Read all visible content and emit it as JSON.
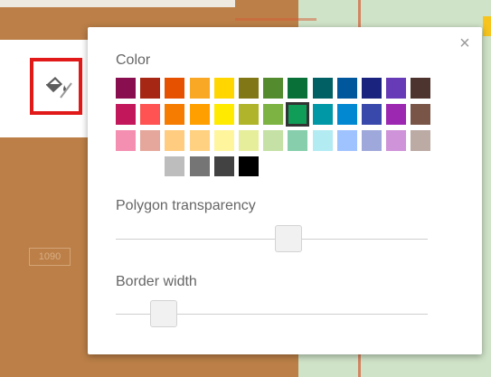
{
  "map": {
    "label_box": "1090"
  },
  "toolbar": {
    "fill_icon": "paint-bucket-icon"
  },
  "popup": {
    "close_label": "×",
    "color_label": "Color",
    "transparency_label": "Polygon transparency",
    "border_label": "Border width",
    "transparency_value": 0.56,
    "border_width_value": 0.12,
    "selected_color": "#0f9d58",
    "palette": [
      [
        "#880e4f",
        "#a52714",
        "#e65100",
        "#f9a825",
        "#ffd600",
        "#817717",
        "#558b2f",
        "#097138",
        "#006064",
        "#01579b",
        "#1a237e",
        "#673ab7",
        "#4e342e"
      ],
      [
        "#c2185b",
        "#ff5252",
        "#f57c00",
        "#ffa000",
        "#ffea00",
        "#afb42b",
        "#7cb342",
        "#0f9d58",
        "#0097a7",
        "#0288d1",
        "#3949ab",
        "#9c27b0",
        "#795548"
      ],
      [
        "#f48fb1",
        "#e5a79c",
        "#ffcc80",
        "#ffd180",
        "#fff59d",
        "#e6ee9c",
        "#c5e1a5",
        "#87ceac",
        "#b2ebf2",
        "#9fc3ff",
        "#9fa8da",
        "#ce93d8",
        "#bcaaa4"
      ],
      [
        "#ffffff",
        "#bdbdbd",
        "#757575",
        "#424242",
        "#000000"
      ]
    ]
  }
}
